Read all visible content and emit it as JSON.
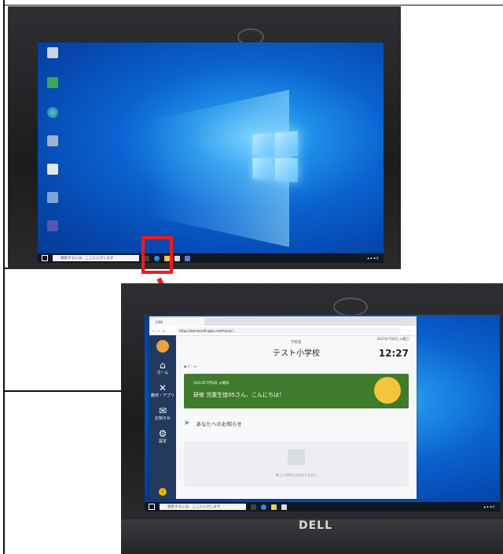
{
  "colors": {
    "accent_red": "#ee1c1c",
    "sidebar": "#233a5e",
    "banner_green": "#3e7b2c",
    "desktop_blue": "#0a62d0"
  },
  "top_photo": {
    "desktop_icons": [
      {
        "name": "recycle-bin-icon"
      },
      {
        "name": "app-shortcut-icon"
      },
      {
        "name": "edge-icon"
      },
      {
        "name": "network-icon"
      },
      {
        "name": "folder-shortcut-icon"
      },
      {
        "name": "settings-shortcut-icon"
      },
      {
        "name": "teams-icon"
      }
    ],
    "taskbar": {
      "search_placeholder": "検索するには、ここに入力します"
    },
    "highlighted_icon": "edge-icon"
  },
  "bottom_photo": {
    "browser": {
      "tab_title": "C4th",
      "url": "https://kanseisoft-gaku.net/home/..."
    },
    "app": {
      "sidebar_items": [
        {
          "icon": "home-icon",
          "label": "ホーム"
        },
        {
          "icon": "tools-icon",
          "label": "教材・アプリ"
        },
        {
          "icon": "mail-icon",
          "label": "お知らせ"
        },
        {
          "icon": "gear-icon",
          "label": "設定"
        }
      ],
      "school_sub": "学校名",
      "school_name": "テスト小学校",
      "date": "2021年7月6日 火曜日",
      "time": "12:27",
      "breadcrumb": "● ホーム",
      "banner": {
        "date": "2021年7月6日 火曜日",
        "message": "研修 児童生徒05さん、こんにちは！"
      },
      "notice_heading": "あなたへのお知らせ",
      "notice_empty": "新しいお知らせはありません"
    },
    "taskbar": {
      "search_placeholder": "検索するには、ここに入力します"
    },
    "brand": "DELL"
  }
}
